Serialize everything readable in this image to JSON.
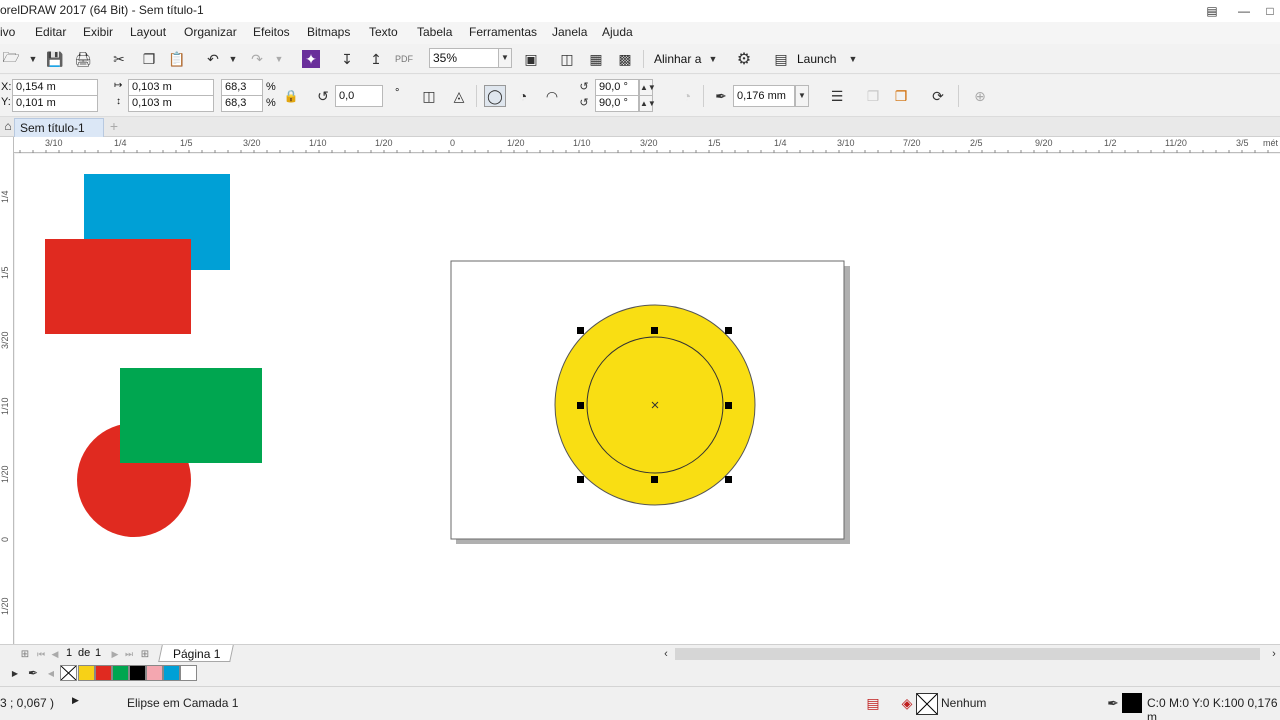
{
  "window": {
    "title": "orelDRAW 2017 (64 Bit) - Sem título-1"
  },
  "menu": [
    "ivo",
    "Editar",
    "Exibir",
    "Layout",
    "Organizar",
    "Efeitos",
    "Bitmaps",
    "Texto",
    "Tabela",
    "Ferramentas",
    "Janela",
    "Ajuda"
  ],
  "standard_toolbar": {
    "zoom": "35%",
    "align_label": "Alinhar a",
    "launch_label": "Launch",
    "pdf_label": "PDF"
  },
  "property_bar": {
    "x_label": "X:",
    "x_value": "0,154 m",
    "y_label": "Y:",
    "y_value": "0,101 m",
    "width_value": "0,103 m",
    "height_value": "0,103 m",
    "scale_w": "68,3",
    "scale_h": "68,3",
    "percent": "%",
    "rotation": "0,0",
    "degree_symbol": "°",
    "start_angle": "90,0 °",
    "end_angle": "90,0 °",
    "outline_width": "0,176 mm"
  },
  "document_tab": {
    "label": "Sem título-1"
  },
  "h_ruler_ticks": [
    "3/10",
    "1/4",
    "1/5",
    "3/20",
    "1/10",
    "1/20",
    "0",
    "1/20",
    "1/10",
    "3/20",
    "1/5",
    "1/4",
    "3/10",
    "7/20",
    "2/5",
    "9/20",
    "1/2",
    "11/20",
    "3/5",
    "mét"
  ],
  "v_ruler_ticks": [
    "1/4",
    "1/5",
    "3/20",
    "1/10",
    "1/20",
    "0",
    "1/20"
  ],
  "page_nav": {
    "current": "1",
    "of_label": "de",
    "total": "1",
    "page_tab": "Página 1"
  },
  "palette": {
    "colors": [
      "#f7d117",
      "#e02a20",
      "#00a650",
      "#000000",
      "#f4a7b0",
      "#00a0d6",
      "#ffffff"
    ]
  },
  "status": {
    "coords": "3 ; 0,067 )",
    "object_info": "Elipse em Camada 1",
    "fill_label": "Nenhum",
    "outline_info": "C:0 M:0 Y:0 K:100  0,176 m"
  },
  "colors": {
    "blue": "#00a0d6",
    "red": "#e02a20",
    "green": "#00a650",
    "yellow": "#f9de13"
  }
}
